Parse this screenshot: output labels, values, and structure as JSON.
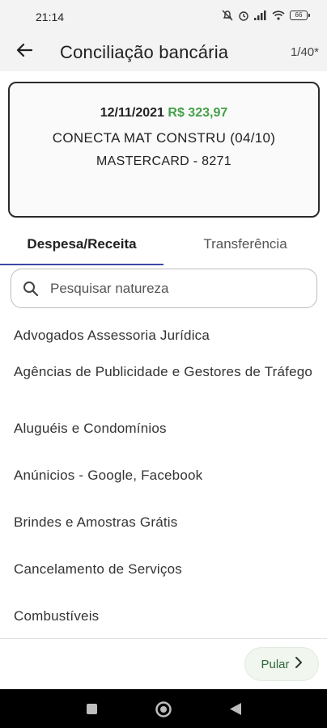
{
  "status_bar": {
    "time": "21:14",
    "battery": "66"
  },
  "app_bar": {
    "title": "Conciliação bancária",
    "counter": "1/40*"
  },
  "transaction": {
    "date": "12/11/2021",
    "amount": "R$ 323,97",
    "description": "CONECTA MAT CONSTRU (04/10)",
    "account": "MASTERCARD - 8271",
    "amount_color": "#43a047"
  },
  "tabs": [
    {
      "label": "Despesa/Receita",
      "active": true
    },
    {
      "label": "Transferência",
      "active": false
    }
  ],
  "search": {
    "placeholder": "Pesquisar natureza",
    "value": ""
  },
  "natures": [
    "Advogados Assessoria Jurídica",
    "Agências de Publicidade e Gestores de Tráfego",
    "Aluguéis e Condomínios",
    "Anúnicios - Google, Facebook",
    "Brindes e Amostras Grátis",
    "Cancelamento de Serviços",
    "Combustíveis"
  ],
  "actions": {
    "skip_label": "Pular"
  },
  "colors": {
    "accent": "#3e4aa8",
    "positive": "#43a047",
    "skip_button_bg": "#f1f6ee"
  }
}
